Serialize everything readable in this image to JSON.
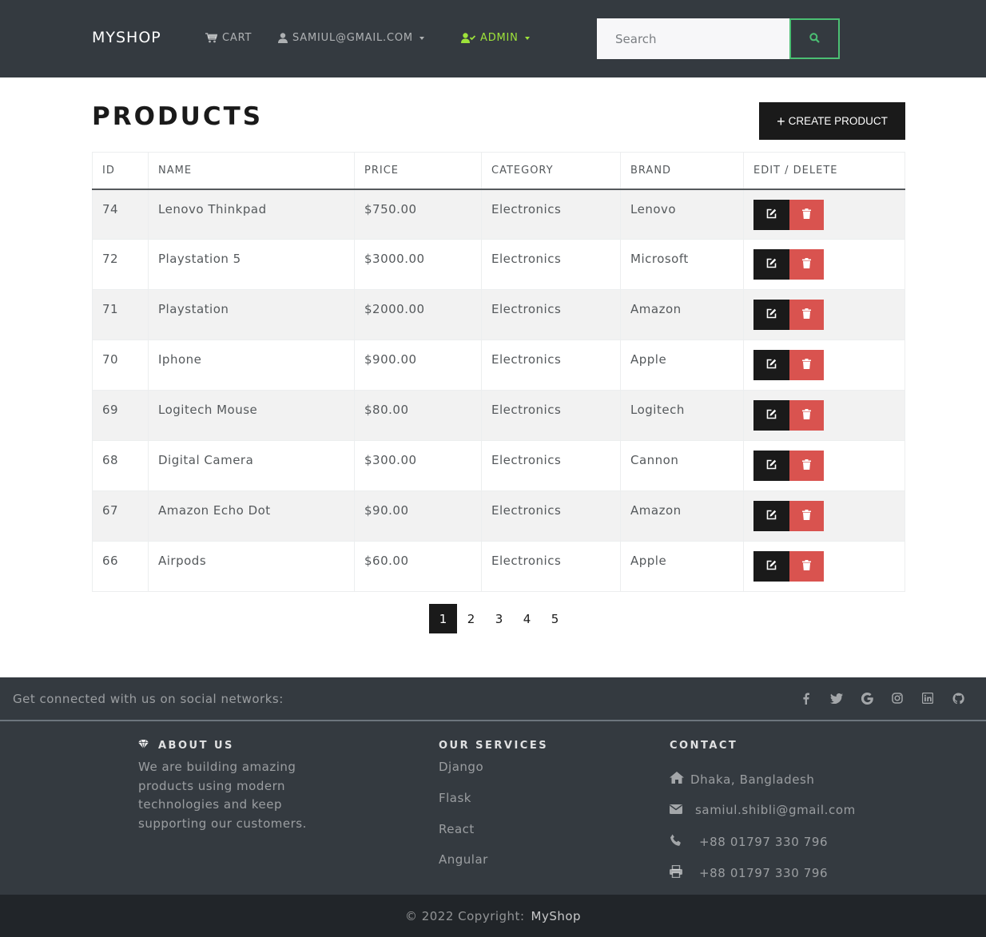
{
  "navbar": {
    "brand": "MYSHOP",
    "cart_label": "CART",
    "user_label": "SAMIUL@GMAIL.COM",
    "admin_label": "ADMIN",
    "search_placeholder": "Search",
    "admin_color": "#9ee33a",
    "search_button_border": "#4bbf73"
  },
  "main": {
    "title": "PRODUCTS",
    "create_button": "CREATE PRODUCT",
    "table": {
      "headers": [
        "ID",
        "NAME",
        "PRICE",
        "CATEGORY",
        "BRAND",
        "EDIT / DELETE"
      ],
      "rows": [
        {
          "id": "74",
          "name": "Lenovo Thinkpad",
          "price": "$750.00",
          "category": "Electronics",
          "brand": "Lenovo"
        },
        {
          "id": "72",
          "name": "Playstation 5",
          "price": "$3000.00",
          "category": "Electronics",
          "brand": "Microsoft"
        },
        {
          "id": "71",
          "name": "Playstation",
          "price": "$2000.00",
          "category": "Electronics",
          "brand": "Amazon"
        },
        {
          "id": "70",
          "name": "Iphone",
          "price": "$900.00",
          "category": "Electronics",
          "brand": "Apple"
        },
        {
          "id": "69",
          "name": "Logitech Mouse",
          "price": "$80.00",
          "category": "Electronics",
          "brand": "Logitech"
        },
        {
          "id": "68",
          "name": "Digital Camera",
          "price": "$300.00",
          "category": "Electronics",
          "brand": "Cannon"
        },
        {
          "id": "67",
          "name": "Amazon Echo Dot",
          "price": "$90.00",
          "category": "Electronics",
          "brand": "Amazon"
        },
        {
          "id": "66",
          "name": "Airpods",
          "price": "$60.00",
          "category": "Electronics",
          "brand": "Apple"
        }
      ]
    },
    "pagination": {
      "pages": [
        "1",
        "2",
        "3",
        "4",
        "5"
      ],
      "active": "1"
    }
  },
  "footer": {
    "social_text": "Get connected with us on social networks:",
    "social_icons": [
      "facebook-icon",
      "twitter-icon",
      "google-icon",
      "instagram-icon",
      "linkedin-icon",
      "github-icon"
    ],
    "about": {
      "heading": "ABOUT US",
      "text": "We are building amazing products using modern technologies and keep supporting our customers."
    },
    "services": {
      "heading": "OUR SERVICES",
      "items": [
        "Django",
        "Flask",
        "React",
        "Angular"
      ]
    },
    "contact": {
      "heading": "CONTACT",
      "address": "Dhaka, Bangladesh",
      "email": "samiul.shibli@gmail.com",
      "phone": "+88 01797 330 796",
      "fax": "+88 01797 330 796"
    },
    "copyright": "© 2022 Copyright:",
    "copyright_brand": "MyShop"
  },
  "colors": {
    "navbar_bg": "#343a40",
    "primary_dark": "#1a1a1a",
    "danger": "#d9534f",
    "footer_bottom_bg": "#212529"
  }
}
